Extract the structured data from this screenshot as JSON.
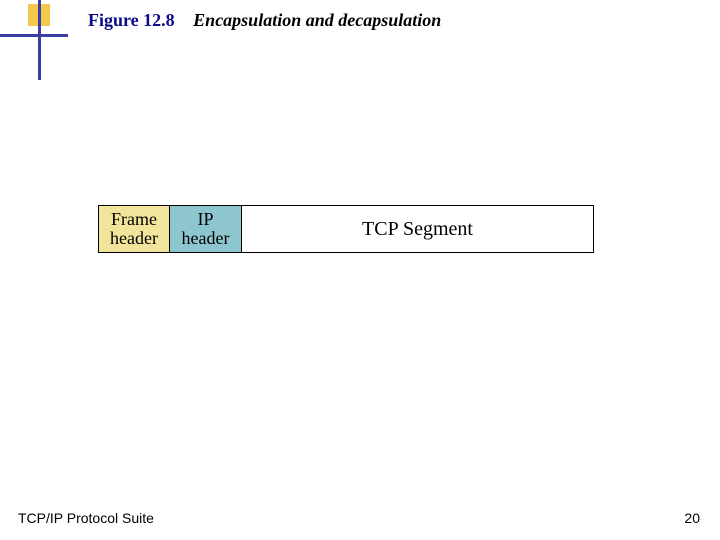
{
  "header": {
    "figure_number": "Figure 12.8",
    "figure_title": "Encapsulation and decapsulation"
  },
  "diagram": {
    "cells": [
      {
        "label_line1": "Frame",
        "label_line2": "header",
        "fill": "#f2e49b"
      },
      {
        "label_line1": "IP",
        "label_line2": "header",
        "fill": "#8ec6cf"
      },
      {
        "label_line1": "TCP  Segment",
        "label_line2": "",
        "fill": "#ffffff"
      }
    ]
  },
  "footer": {
    "left": "TCP/IP Protocol Suite",
    "page_number": "20"
  }
}
